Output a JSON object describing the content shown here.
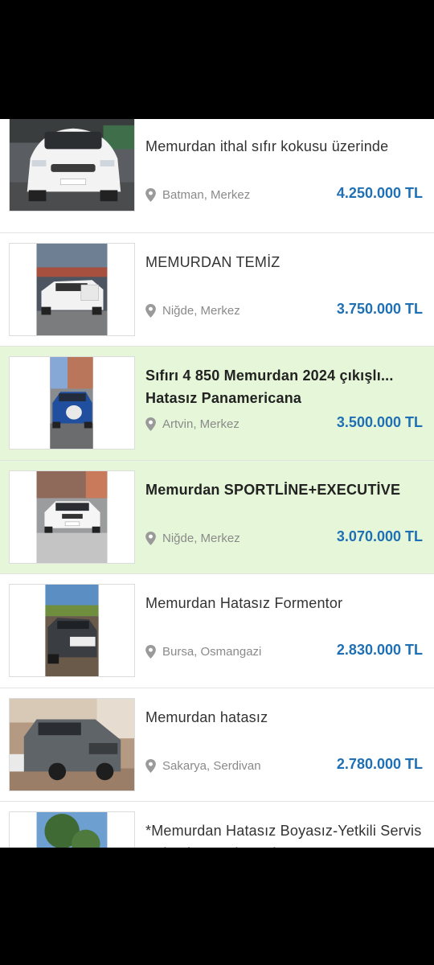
{
  "listings": [
    {
      "title": "Memurdan ithal sıfır kokusu üzerinde",
      "location": "Batman, Merkez",
      "price": "4.250.000 TL",
      "highlight": false,
      "image_icon": "white-suv-photo"
    },
    {
      "title": "MEMURDAN TEMİZ",
      "location": "Niğde, Merkez",
      "price": "3.750.000 TL",
      "highlight": false,
      "image_icon": "white-suv-doors-open-photo"
    },
    {
      "title": "Sıfırı 4 850 Memurdan 2024 çıkışlı... Hatasız Panamericana",
      "location": "Artvin, Merkez",
      "price": "3.500.000 TL",
      "highlight": true,
      "image_icon": "blue-car-photo"
    },
    {
      "title": "Memurdan SPORTLİNE+EXECUTİVE",
      "location": "Niğde, Merkez",
      "price": "3.070.000 TL",
      "highlight": true,
      "image_icon": "white-sedan-photo"
    },
    {
      "title": "Memurdan Hatasız Formentor",
      "location": "Bursa, Osmangazi",
      "price": "2.830.000 TL",
      "highlight": false,
      "image_icon": "dark-crossover-photo"
    },
    {
      "title": "Memurdan hatasız",
      "location": "Sakarya, Serdivan",
      "price": "2.780.000 TL",
      "highlight": false,
      "image_icon": "grey-suv-photo"
    },
    {
      "title": "*Memurdan Hatasız Boyasız-Yetkili Servis Bakımlı-Premium Pkt*",
      "location": "",
      "price": "",
      "highlight": false,
      "image_icon": "tree-car-photo"
    }
  ],
  "colors": {
    "price": "#1f6fb5",
    "highlight_bg": "#e6f7d9",
    "location": "#8a8a8a"
  }
}
